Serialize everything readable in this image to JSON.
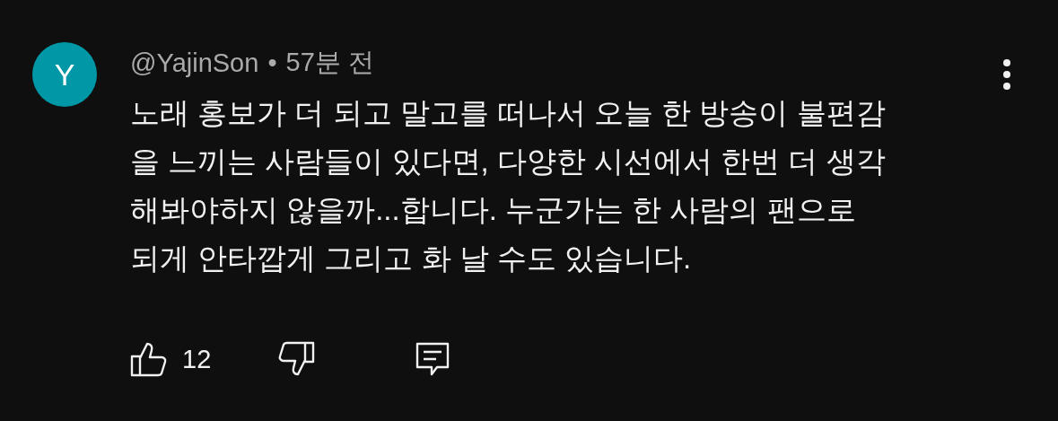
{
  "comment": {
    "avatar_letter": "Y",
    "author": "@YajinSon",
    "separator": "•",
    "time": "57분 전",
    "text_lines": [
      "노래 홍보가 더 되고 말고를 떠나서 오늘 한 방송이 불편감",
      "을 느끼는 사람들이 있다면, 다양한 시선에서 한번 더 생각",
      "해봐야하지 않을까...합니다. 누군가는 한 사람의 팬으로",
      "되게 안타깝게 그리고 화 날 수도 있습니다."
    ],
    "like_count": "12"
  }
}
